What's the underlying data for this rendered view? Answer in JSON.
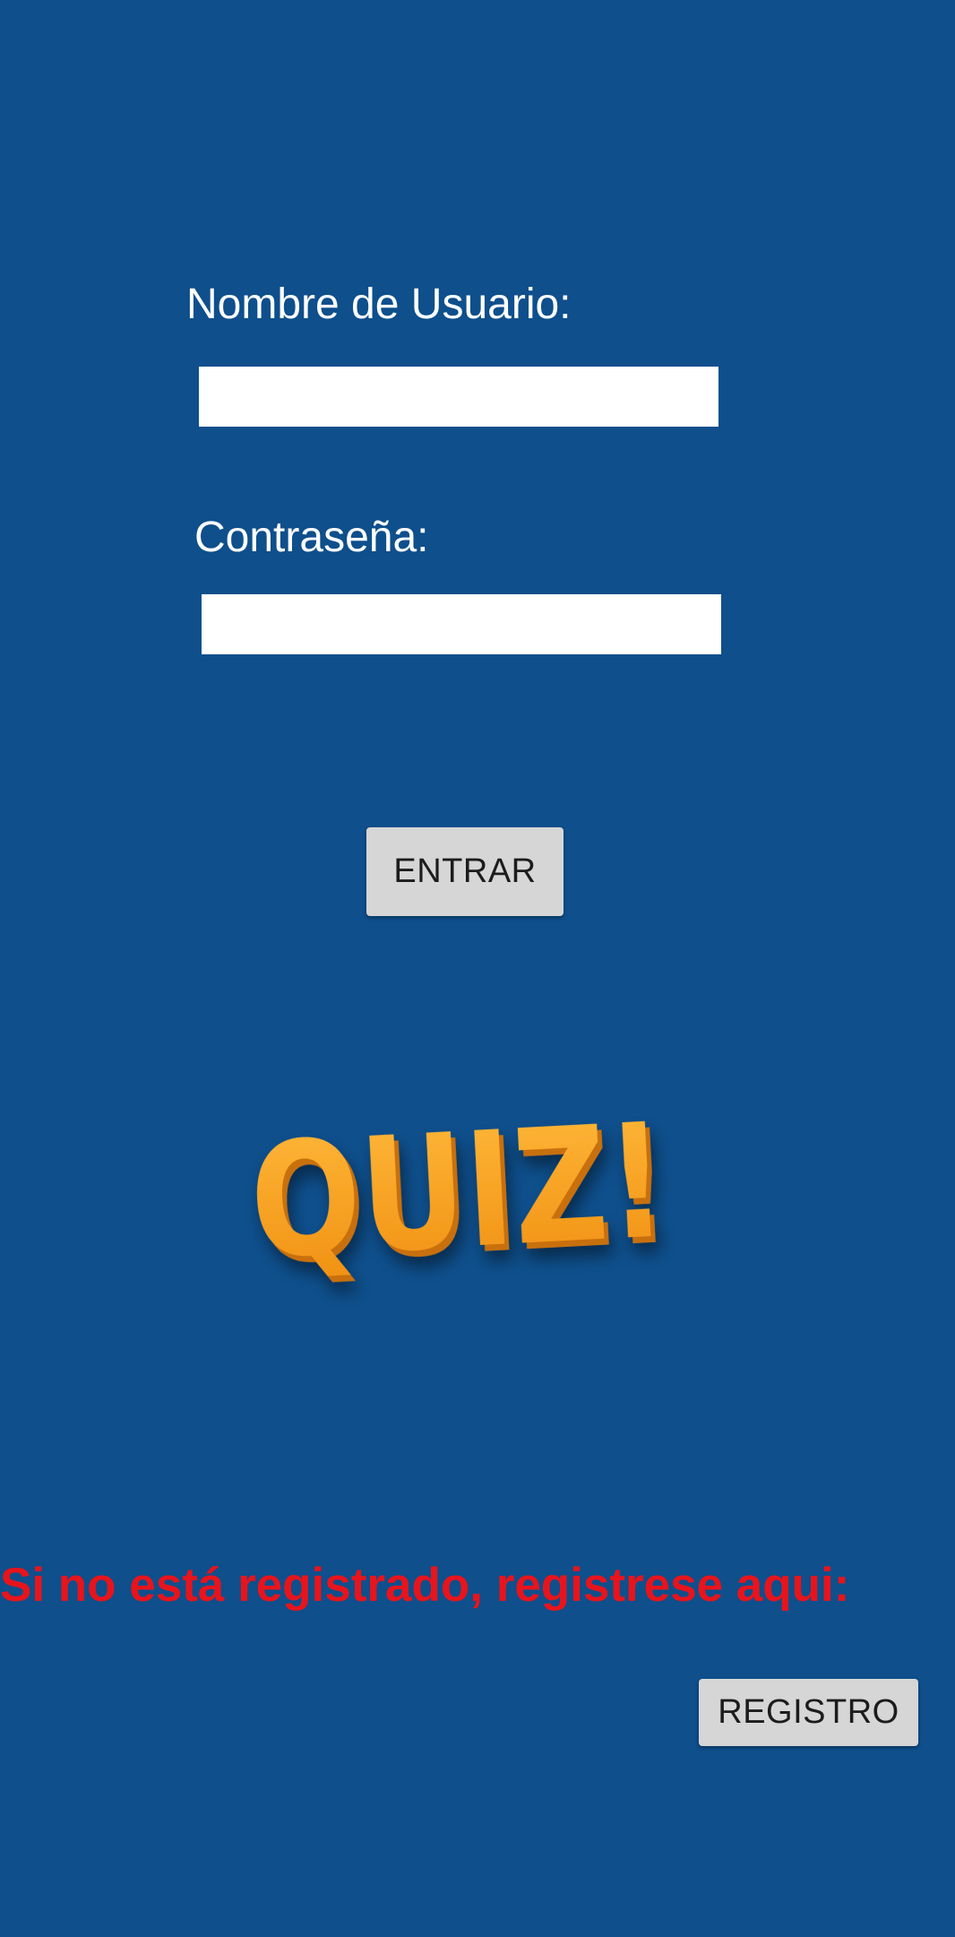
{
  "login": {
    "username_label": "Nombre de Usuario:",
    "username_value": "",
    "password_label": "Contraseña:",
    "password_value": "",
    "enter_button": "ENTRAR"
  },
  "logo": {
    "text": "QUIZ!",
    "color": "#f7a01d"
  },
  "register": {
    "prompt": "Si no está registrado, registrese aqui:",
    "button": "REGISTRO",
    "prompt_color": "#e8141c"
  },
  "theme": {
    "background": "#0e4f8c"
  }
}
